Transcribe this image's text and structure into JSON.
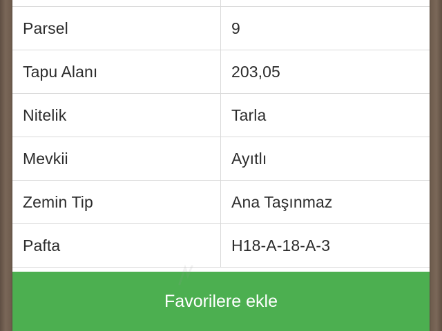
{
  "details": {
    "rows": [
      {
        "key": "",
        "value": ""
      },
      {
        "key": "Parsel",
        "value": "9"
      },
      {
        "key": "Tapu Alanı",
        "value": "203,05"
      },
      {
        "key": "Nitelik",
        "value": "Tarla"
      },
      {
        "key": "Mevkii",
        "value": "Ayıtlı"
      },
      {
        "key": "Zemin Tip",
        "value": "Ana Taşınmaz"
      },
      {
        "key": "Pafta",
        "value": "H18-A-18-A-3"
      }
    ]
  },
  "actions": {
    "favorite_label": "Favorilere ekle"
  },
  "colors": {
    "button_green": "#4caf50",
    "background_brown": "#6b5a4c"
  }
}
